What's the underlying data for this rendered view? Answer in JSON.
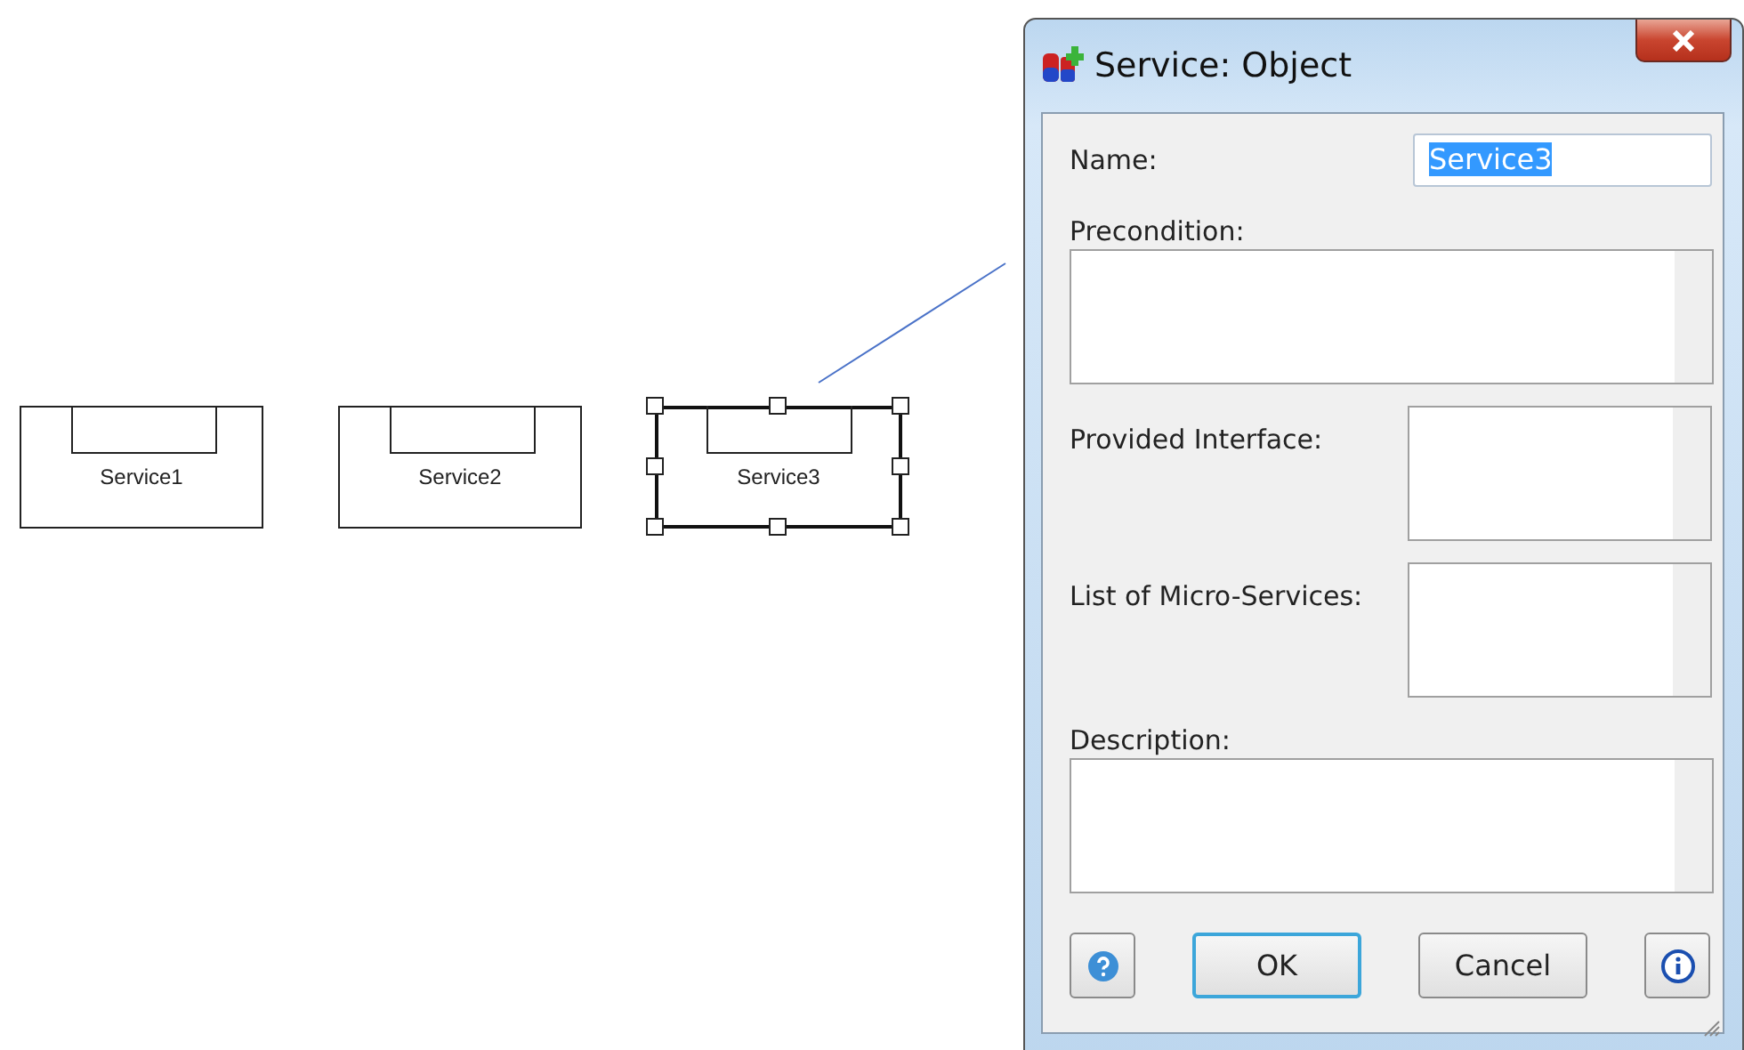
{
  "diagram": {
    "nodes": [
      {
        "label": "Service1",
        "selected": false
      },
      {
        "label": "Service2",
        "selected": false
      },
      {
        "label": "Service3",
        "selected": true
      }
    ]
  },
  "dialog": {
    "title": "Service: Object",
    "fields": [
      {
        "kind": "line",
        "label": "Name:",
        "value": "Service3",
        "selected": true
      },
      {
        "kind": "wide",
        "label": "Precondition:"
      },
      {
        "kind": "side",
        "label": "Provided Interface:"
      },
      {
        "kind": "side",
        "label": "List of Micro-Services:"
      },
      {
        "kind": "wide",
        "label": "Description:"
      }
    ],
    "buttons": [
      {
        "kind": "help"
      },
      {
        "kind": "text",
        "label": "OK",
        "default": true
      },
      {
        "kind": "text",
        "label": "Cancel",
        "default": false
      },
      {
        "kind": "info"
      }
    ]
  }
}
